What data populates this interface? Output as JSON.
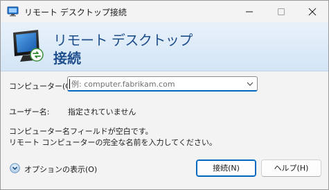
{
  "window": {
    "title": "リモート デスクトップ接続",
    "icon": "remote-desktop-icon",
    "controls": [
      "minimize-icon",
      "maximize-icon",
      "close-icon"
    ]
  },
  "banner": {
    "line1": "リモート デスクトップ",
    "line2": "接続",
    "icon": "monitor-icon"
  },
  "form": {
    "computer_label": "コンピューター(C):",
    "computer_placeholder": "例: computer.fabrikam.com",
    "computer_value": "",
    "username_label": "ユーザー名:",
    "username_value": "指定されていません",
    "message_line1": "コンピューター名フィールドが空白です。",
    "message_line2": "リモート コンピューターの完全な名前を入力してください。"
  },
  "footer": {
    "options_label": "オプションの表示(O)",
    "options_icon": "chevron-down-circle-icon",
    "connect_label": "接続(N)",
    "help_label": "ヘルプ(H)"
  },
  "colors": {
    "accent": "#0067c0",
    "banner_text": "#1f4e8c",
    "banner_bg_top": "#e8f1fa",
    "banner_bg_bottom": "#d3e5f6"
  }
}
